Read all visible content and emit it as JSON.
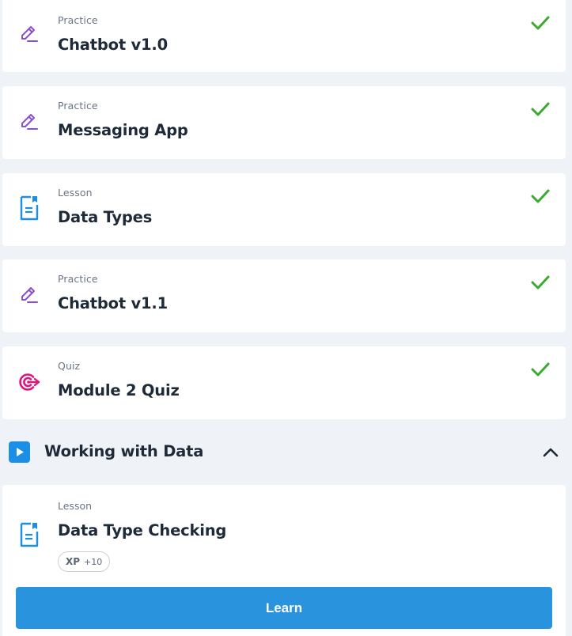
{
  "completed_items": [
    {
      "type": "Practice",
      "title": "Chatbot v1.0",
      "icon": "pencil-practice-icon",
      "status_icon": "check-icon"
    },
    {
      "type": "Practice",
      "title": "Messaging App",
      "icon": "pencil-practice-icon",
      "status_icon": "check-icon"
    },
    {
      "type": "Lesson",
      "title": "Data Types",
      "icon": "document-lesson-icon",
      "status_icon": "check-icon"
    },
    {
      "type": "Practice",
      "title": "Chatbot v1.1",
      "icon": "pencil-practice-icon",
      "status_icon": "check-icon"
    },
    {
      "type": "Quiz",
      "title": "Module 2 Quiz",
      "icon": "target-quiz-icon",
      "status_icon": "check-icon"
    }
  ],
  "section": {
    "title": "Working with Data",
    "icon": "play-icon",
    "toggle_icon": "chevron-up-icon"
  },
  "active_item": {
    "type": "Lesson",
    "title": "Data Type Checking",
    "icon": "document-lesson-icon",
    "xp_label": "XP",
    "xp_value": "+10",
    "button_label": "Learn"
  },
  "colors": {
    "background": "#eff2f6",
    "card": "#ffffff",
    "check_green": "#3bab2e",
    "practice_purple": "#8a4fd8",
    "lesson_blue": "#1b8fe6",
    "quiz_pink": "#e0157a",
    "button_blue": "#2a93de",
    "text_dark": "#1e2a38",
    "text_muted": "#6a7585"
  }
}
